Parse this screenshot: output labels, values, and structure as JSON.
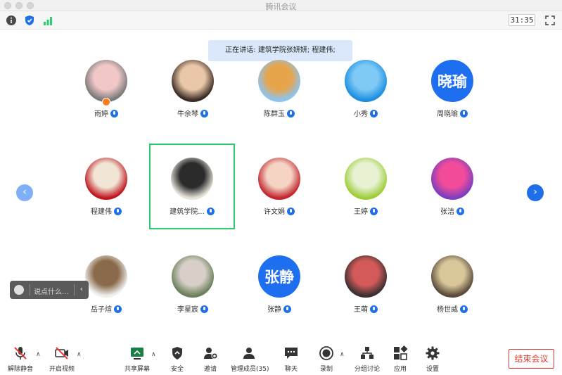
{
  "window": {
    "title": "腾讯会议"
  },
  "topbar": {
    "timer": "31:35"
  },
  "speaking_banner": {
    "text": "正在讲话: 建筑学院张妍妍; 程建伟;"
  },
  "participants": [
    {
      "name": "雨婷",
      "avatar_type": "photo",
      "avatar_colors": [
        "#7a7a7a",
        "#f1c7c7"
      ],
      "host": true
    },
    {
      "name": "牛余琴",
      "avatar_type": "photo",
      "avatar_colors": [
        "#3a2b24",
        "#e9c7a8"
      ]
    },
    {
      "name": "陈群玉",
      "avatar_type": "photo",
      "avatar_colors": [
        "#8cc4f2",
        "#e7a54b"
      ]
    },
    {
      "name": "小秀",
      "avatar_type": "photo",
      "avatar_colors": [
        "#1c8fe0",
        "#7ec9f5"
      ]
    },
    {
      "name": "周晓瑜",
      "avatar_type": "text",
      "avatar_text": "晓瑜"
    },
    {
      "name": "程建伟",
      "avatar_type": "photo",
      "avatar_colors": [
        "#c0171f",
        "#f1e5d6"
      ]
    },
    {
      "name": "建筑学院...",
      "avatar_type": "photo",
      "avatar_colors": [
        "#e8e2da",
        "#2b2b2b"
      ],
      "active": true
    },
    {
      "name": "许文娟",
      "avatar_type": "photo",
      "avatar_colors": [
        "#c3262f",
        "#f5d4c4"
      ]
    },
    {
      "name": "王婷",
      "avatar_type": "photo",
      "avatar_colors": [
        "#9dcd3b",
        "#e8f2d2"
      ]
    },
    {
      "name": "张洁",
      "avatar_type": "photo",
      "avatar_colors": [
        "#7c3fbf",
        "#f24b9a"
      ]
    },
    {
      "name": "岳子煊",
      "avatar_type": "photo",
      "avatar_colors": [
        "#f0f0f0",
        "#8a6a4a"
      ]
    },
    {
      "name": "李星宸",
      "avatar_type": "photo",
      "avatar_colors": [
        "#6a7f5a",
        "#d8d0c8"
      ]
    },
    {
      "name": "张静",
      "avatar_type": "text",
      "avatar_text": "张静"
    },
    {
      "name": "王萌",
      "avatar_type": "photo",
      "avatar_colors": [
        "#3a3030",
        "#d45a5a"
      ]
    },
    {
      "name": "杨世威",
      "avatar_type": "photo",
      "avatar_colors": [
        "#5a4a3a",
        "#d9c79a"
      ]
    }
  ],
  "chat_popup": {
    "placeholder": "说点什么..."
  },
  "toolbar": {
    "unmute": "解除静音",
    "start_video": "开启视频",
    "share_screen": "共享屏幕",
    "security": "安全",
    "invite": "邀请",
    "manage_members": "管理成员(35)",
    "chat": "聊天",
    "record": "录制",
    "breakout": "分组讨论",
    "apps": "应用",
    "settings": "设置",
    "end_meeting": "结束会议"
  },
  "colors": {
    "accent_blue": "#1f6fe8",
    "active_border": "#2ecc71",
    "danger_red": "#e53935",
    "banner_bg": "#dbe8fb"
  }
}
